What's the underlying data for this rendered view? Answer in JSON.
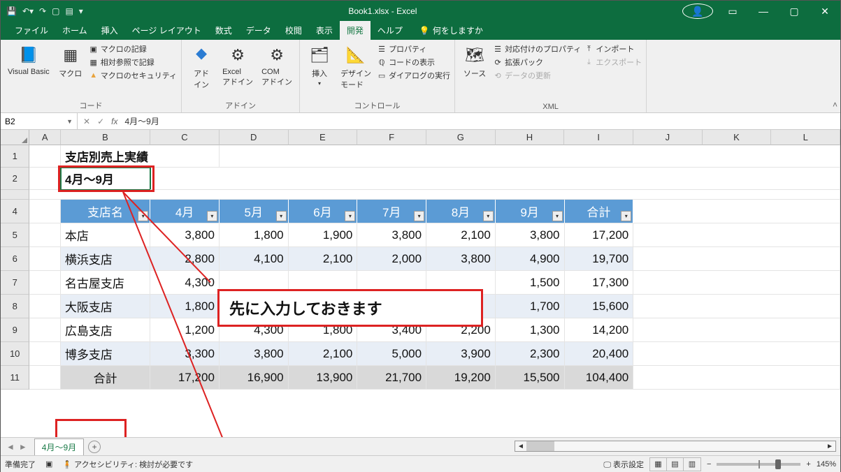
{
  "title": "Book1.xlsx - Excel",
  "menu": {
    "file": "ファイル",
    "home": "ホーム",
    "insert": "挿入",
    "pagelayout": "ページ レイアウト",
    "formulas": "数式",
    "data": "データ",
    "review": "校閲",
    "view": "表示",
    "dev": "開発",
    "help": "ヘルプ",
    "tell": "何をしますか"
  },
  "ribbon": {
    "vb": "Visual Basic",
    "macro": "マクロ",
    "rec": "マクロの記録",
    "relref": "相対参照で記録",
    "sec": "マクロのセキュリティ",
    "code_lbl": "コード",
    "addin": "アド\nイン",
    "exaddin": "Excel\nアドイン",
    "comaddin": "COM\nアドイン",
    "addin_lbl": "アドイン",
    "ins": "挿入",
    "design": "デザイン\nモード",
    "prop": "プロパティ",
    "showcode": "コードの表示",
    "dialog": "ダイアログの実行",
    "ctrl_lbl": "コントロール",
    "source": "ソース",
    "mapprop": "対応付けのプロパティ",
    "exp": "拡張パック",
    "refresh": "データの更新",
    "import": "インポート",
    "export": "エクスポート",
    "xml_lbl": "XML"
  },
  "namebox": "B2",
  "formula": "4月～9月",
  "cols": [
    "A",
    "B",
    "C",
    "D",
    "E",
    "F",
    "G",
    "H",
    "I",
    "J",
    "K",
    "L"
  ],
  "rows": [
    "1",
    "2",
    "4",
    "5",
    "6",
    "7",
    "8",
    "9",
    "10",
    "11"
  ],
  "cellB1": "支店別売上実績",
  "cellB2": "4月～9月",
  "hdr": {
    "b": "支店名",
    "c": "4月",
    "d": "5月",
    "e": "6月",
    "f": "7月",
    "g": "8月",
    "h": "9月",
    "i": "合計"
  },
  "data": [
    {
      "b": "本店",
      "c": "3,800",
      "d": "1,800",
      "e": "1,900",
      "f": "3,800",
      "g": "2,100",
      "h": "3,800",
      "i": "17,200"
    },
    {
      "b": "横浜支店",
      "c": "2,800",
      "d": "4,100",
      "e": "2,100",
      "f": "2,000",
      "g": "3,800",
      "h": "4,900",
      "i": "19,700"
    },
    {
      "b": "名古屋支店",
      "c": "4,300",
      "d": "",
      "e": "",
      "f": "",
      "g": "",
      "h": "1,500",
      "i": "17,300"
    },
    {
      "b": "大阪支店",
      "c": "1,800",
      "d": "",
      "e": "",
      "f": "",
      "g": "",
      "h": "1,700",
      "i": "15,600"
    },
    {
      "b": "広島支店",
      "c": "1,200",
      "d": "4,300",
      "e": "1,800",
      "f": "3,400",
      "g": "2,200",
      "h": "1,300",
      "i": "14,200"
    },
    {
      "b": "博多支店",
      "c": "3,300",
      "d": "3,800",
      "e": "2,100",
      "f": "5,000",
      "g": "3,900",
      "h": "2,300",
      "i": "20,400"
    }
  ],
  "total": {
    "b": "合計",
    "c": "17,200",
    "d": "16,900",
    "e": "13,900",
    "f": "21,700",
    "g": "19,200",
    "h": "15,500",
    "i": "104,400"
  },
  "callout": "先に入力しておきます",
  "sheet": "4月～9月",
  "status": {
    "ready": "準備完了",
    "acc": "アクセシビリティ: 検討が必要です",
    "disp": "表示設定",
    "zoom": "145%"
  }
}
